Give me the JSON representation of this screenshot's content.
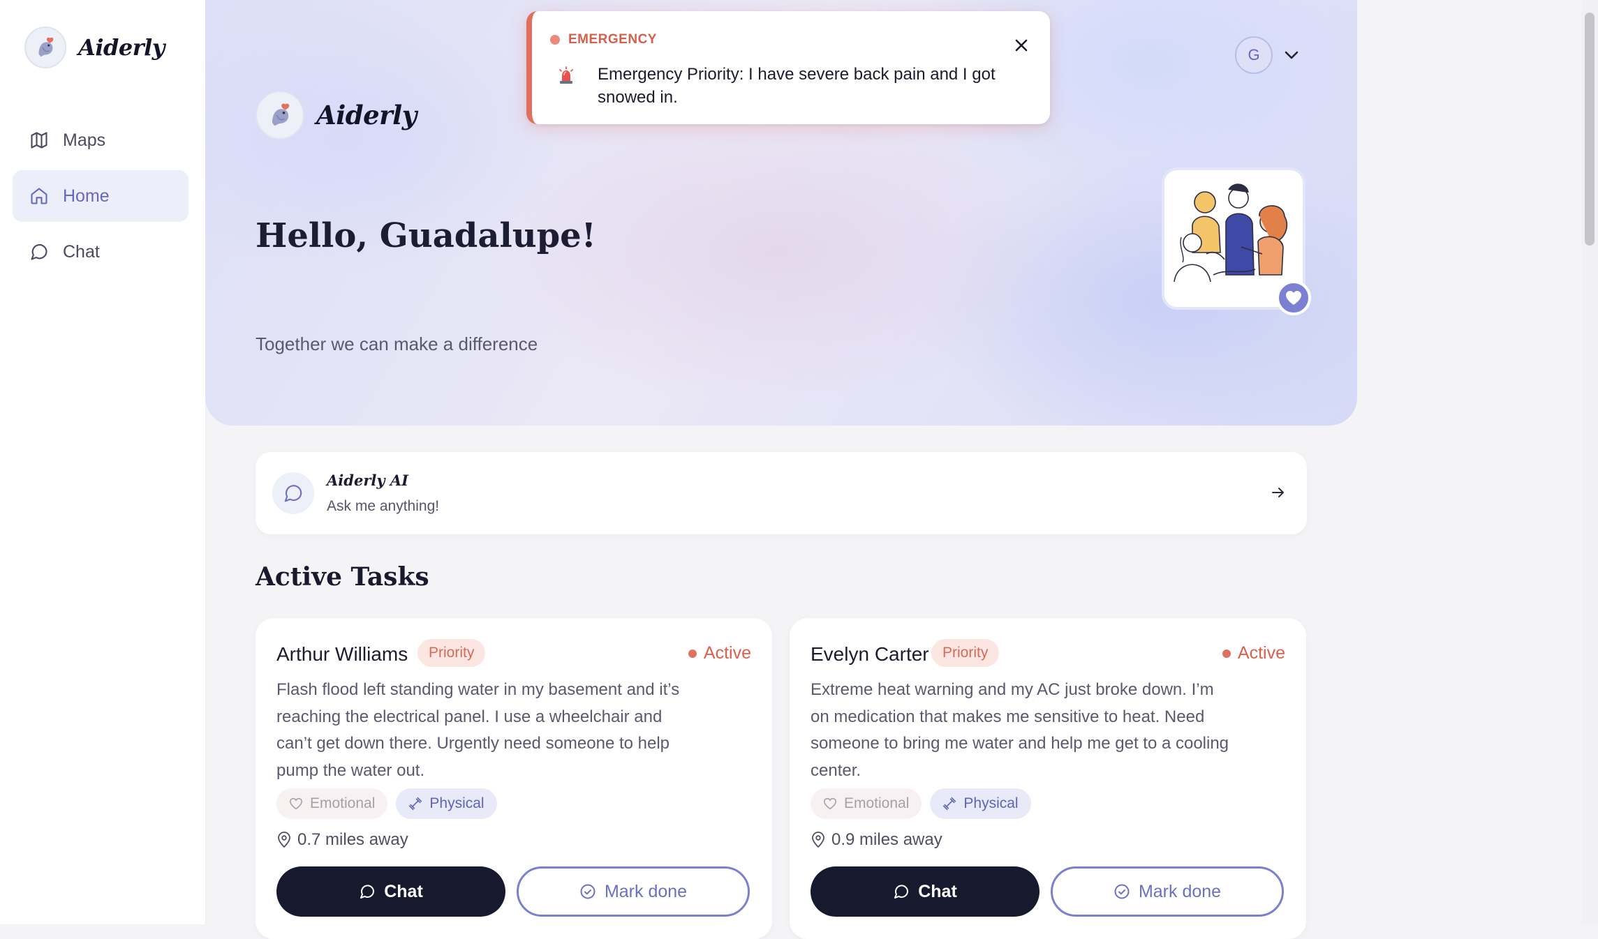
{
  "app": {
    "name": "Aiderly"
  },
  "sidebar": {
    "brand": "Aiderly",
    "items": [
      {
        "label": "Maps",
        "icon": "map-icon",
        "active": false
      },
      {
        "label": "Home",
        "icon": "home-icon",
        "active": true
      },
      {
        "label": "Chat",
        "icon": "chat-bubble-icon",
        "active": false
      }
    ]
  },
  "hero": {
    "brand": "Aiderly",
    "greeting": "Hello, Guadalupe!",
    "tagline": "Together we can make a difference",
    "illustration": "friends-illustration",
    "badge_icon": "heart-icon"
  },
  "user": {
    "initial": "G"
  },
  "toast": {
    "label": "EMERGENCY",
    "icon": "siren-icon",
    "message": "Emergency Priority: I have severe back pain and I got snowed in."
  },
  "ai_card": {
    "title": "Aiderly AI",
    "subtitle": "Ask me anything!"
  },
  "tasks_section": {
    "title": "Active Tasks"
  },
  "tasks": [
    {
      "name": "Arthur Williams",
      "badge": "Priority",
      "status": "Active",
      "description": "Flash flood left standing water in my basement and it’s reaching the electrical panel. I use a wheelchair and can’t get down there. Urgently need someone to help pump the water out.",
      "tags": [
        "Emotional",
        "Physical"
      ],
      "distance": "0.7 miles away",
      "chat_label": "Chat",
      "done_label": "Mark done"
    },
    {
      "name": "Evelyn Carter",
      "badge": "Priority",
      "status": "Active",
      "description": "Extreme heat warning and my AC just broke down. I’m on medication that makes me sensitive to heat. Need someone to bring me water and help me get to a cooling center.",
      "tags": [
        "Emotional",
        "Physical"
      ],
      "distance": "0.9 miles away",
      "chat_label": "Chat",
      "done_label": "Mark done"
    }
  ],
  "colors": {
    "accent": "#6469bf",
    "emergency": "#e0705e",
    "dark_button": "#171a2e"
  }
}
